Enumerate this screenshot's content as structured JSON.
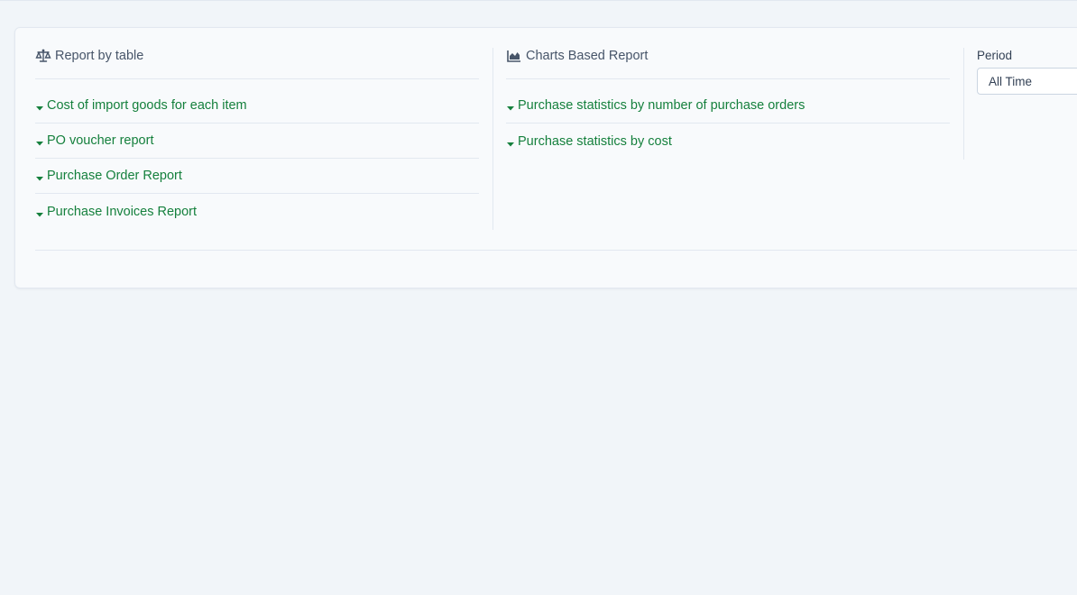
{
  "report_by_table": {
    "title": "Report by table",
    "icon": "balance-scale-icon",
    "items": [
      {
        "label": "Cost of import goods for each item"
      },
      {
        "label": "PO voucher report"
      },
      {
        "label": "Purchase Order Report"
      },
      {
        "label": "Purchase Invoices Report"
      }
    ]
  },
  "charts_based_report": {
    "title": "Charts Based Report",
    "icon": "area-chart-icon",
    "items": [
      {
        "label": "Purchase statistics by number of purchase orders"
      },
      {
        "label": "Purchase statistics by cost"
      }
    ]
  },
  "period": {
    "label": "Period",
    "selected": "All Time"
  },
  "colors": {
    "link": "#15803d",
    "heading": "#475569",
    "background": "#f1f5f9",
    "panel": "#f8fafc",
    "border": "#e2e8f0"
  }
}
